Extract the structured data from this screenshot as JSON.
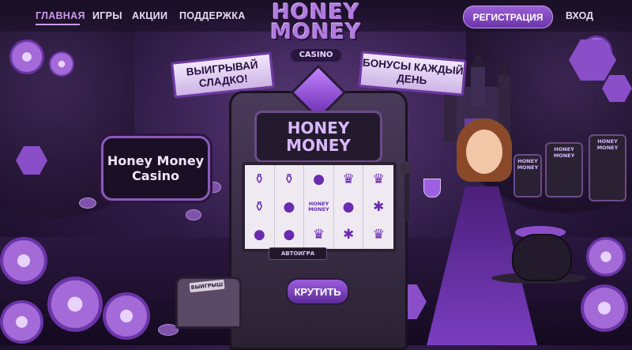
{
  "nav": {
    "items": [
      {
        "label": "ГЛАВНАЯ",
        "active": true
      },
      {
        "label": "ИГРЫ",
        "active": false
      },
      {
        "label": "АКЦИИ",
        "active": false
      },
      {
        "label": "ПОДДЕРЖКА",
        "active": false
      }
    ],
    "register_label": "РЕГИСТРАЦИЯ",
    "login_label": "ВХОД"
  },
  "logo": {
    "line1": "HONEY",
    "line2": "MONEY",
    "sub": "CASINO"
  },
  "banners": {
    "left": "ВЫИГРЫВАЙ СЛАДКО!",
    "right": "БОНУСЫ КАЖДЫЙ ДЕНЬ"
  },
  "sign": {
    "text": "Honey Money Casino"
  },
  "slot_machine": {
    "title": "HONEY MONEY",
    "reel_logo": "HONEY MONEY",
    "autoplay_label": "АВТОИГРА",
    "spin_label": "КРУТИТЬ"
  },
  "chest": {
    "label": "ВЫИГРЫШ"
  },
  "side_machines": {
    "label": "HONEY MONEY"
  },
  "colors": {
    "accent": "#9a5fd6",
    "active_nav": "#c79bea",
    "background": "#2e1b45"
  }
}
